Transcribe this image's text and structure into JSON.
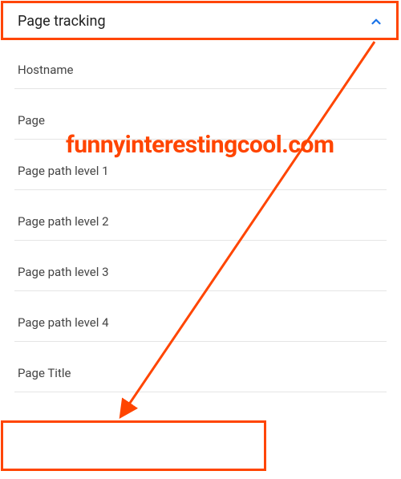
{
  "section": {
    "title": "Page tracking",
    "items": [
      {
        "label": "Hostname"
      },
      {
        "label": "Page"
      },
      {
        "label": "Page path level 1"
      },
      {
        "label": "Page path level 2"
      },
      {
        "label": "Page path level 3"
      },
      {
        "label": "Page path level 4"
      },
      {
        "label": "Page Title"
      }
    ]
  },
  "watermark": "funnyinterestingcool.com",
  "colors": {
    "accent": "#1a73e8",
    "annotation": "#ff4500"
  }
}
